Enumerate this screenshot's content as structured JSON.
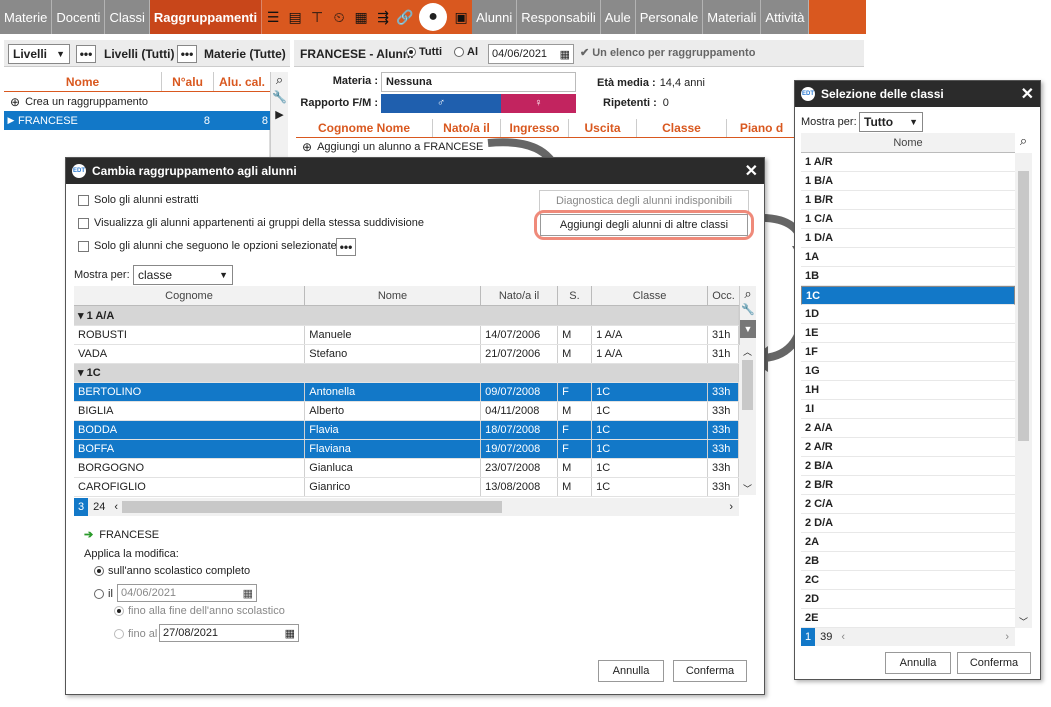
{
  "nav": {
    "tabs": [
      "Materie",
      "Docenti",
      "Classi",
      "Raggruppamenti",
      "Alunni",
      "Responsabili",
      "Aule",
      "Personale",
      "Materiali",
      "Attività"
    ],
    "active": "Raggruppamenti"
  },
  "left": {
    "level_select": "Livelli",
    "levels_all": "Livelli (Tutti)",
    "subjects_all": "Materie (Tutte)",
    "col_name": "Nome",
    "col_nalu": "N°alu",
    "col_alucal": "Alu. cal.",
    "create": "Crea un raggruppamento",
    "group_name": "FRANCESE",
    "group_nalu": "8",
    "group_alucal": "8"
  },
  "right": {
    "title": "FRANCESE - Alunni",
    "radio_all": "Tutti",
    "radio_al": "Al",
    "date": "04/06/2021",
    "single_list": "Un elenco per raggruppamento",
    "materia_label": "Materia :",
    "materia_value": "Nessuna",
    "ratio_label": "Rapporto F/M :",
    "avg_label": "Età media :",
    "avg_value": "14,4 anni",
    "repeat_label": "Ripetenti :",
    "repeat_value": "0",
    "cols": [
      "Cognome Nome",
      "Nato/a il",
      "Ingresso",
      "Uscita",
      "Classe",
      "Piano d"
    ],
    "add_student": "Aggiungi un alunno a FRANCESE"
  },
  "dialog": {
    "title": "Cambia raggruppamento agli alunni",
    "cb1": "Solo gli alunni estratti",
    "cb2": "Visualizza gli alunni appartenenti ai gruppi della stessa suddivisione",
    "cb3": "Solo gli alunni che seguono le opzioni selezionate",
    "btn_diag": "Diagnostica degli alunni indisponibili",
    "btn_add": "Aggiungi degli alunni di altre classi",
    "show_label": "Mostra per:",
    "show_value": "classe",
    "cols": [
      "Cognome",
      "Nome",
      "Nato/a il",
      "S.",
      "Classe",
      "Occ."
    ],
    "group1": "1 A/A",
    "group2": "1C",
    "rows": [
      {
        "c": "ROBUSTI",
        "n": "Manuele",
        "d": "14/07/2006",
        "s": "M",
        "k": "1 A/A",
        "o": "31h"
      },
      {
        "c": "VADA",
        "n": "Stefano",
        "d": "21/07/2006",
        "s": "M",
        "k": "1 A/A",
        "o": "31h"
      },
      {
        "c": "BERTOLINO",
        "n": "Antonella",
        "d": "09/07/2008",
        "s": "F",
        "k": "1C",
        "o": "33h"
      },
      {
        "c": "BIGLIA",
        "n": "Alberto",
        "d": "04/11/2008",
        "s": "M",
        "k": "1C",
        "o": "33h"
      },
      {
        "c": "BODDA",
        "n": "Flavia",
        "d": "18/07/2008",
        "s": "F",
        "k": "1C",
        "o": "33h"
      },
      {
        "c": "BOFFA",
        "n": "Flaviana",
        "d": "19/07/2008",
        "s": "F",
        "k": "1C",
        "o": "33h"
      },
      {
        "c": "BORGOGNO",
        "n": "Gianluca",
        "d": "23/07/2008",
        "s": "M",
        "k": "1C",
        "o": "33h"
      },
      {
        "c": "CAROFIGLIO",
        "n": "Gianrico",
        "d": "13/08/2008",
        "s": "M",
        "k": "1C",
        "o": "33h"
      }
    ],
    "count_sel": "3",
    "count_total": "24",
    "target": "FRANCESE",
    "apply_label": "Applica la modifica:",
    "opt_year": "sull'anno scolastico completo",
    "opt_il": "il",
    "date_il": "04/06/2021",
    "opt_end": "fino alla fine dell'anno scolastico",
    "opt_until": "fino al",
    "date_until": "27/08/2021",
    "cancel": "Annulla",
    "confirm": "Conferma"
  },
  "classes": {
    "title": "Selezione delle classi",
    "show_label": "Mostra per:",
    "show_value": "Tutto",
    "col": "Nome",
    "items": [
      "1 A/R",
      "1 B/A",
      "1 B/R",
      "1 C/A",
      "1 D/A",
      "1A",
      "1B",
      "1C",
      "1D",
      "1E",
      "1F",
      "1G",
      "1H",
      "1I",
      "2 A/A",
      "2 A/R",
      "2 B/A",
      "2 B/R",
      "2 C/A",
      "2 D/A",
      "2A",
      "2B",
      "2C",
      "2D",
      "2E"
    ],
    "selected": "1C",
    "count_sel": "1",
    "count_total": "39",
    "cancel": "Annulla",
    "confirm": "Conferma"
  }
}
